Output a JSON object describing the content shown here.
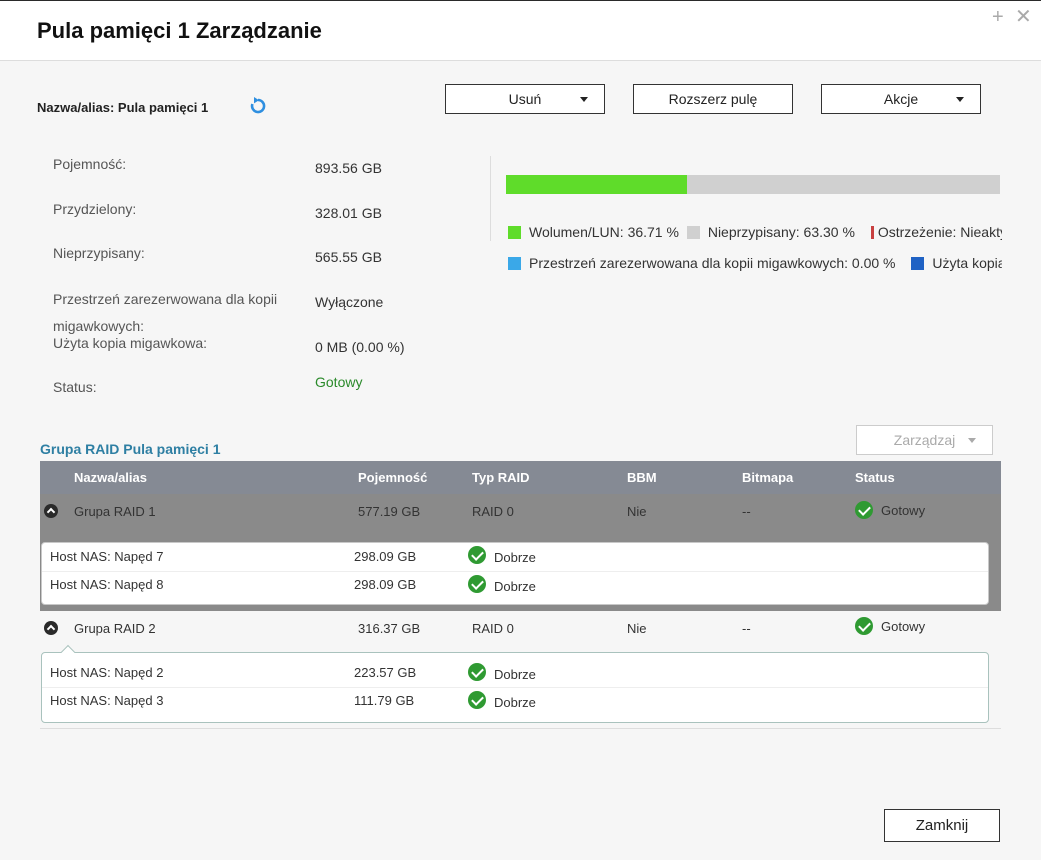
{
  "window": {
    "title": "Pula pamięci 1 Zarządzanie",
    "plus": "+",
    "close": "✕"
  },
  "header": {
    "alias_label": "Nazwa/alias: Pula pamięci 1"
  },
  "toolbar": {
    "remove": "Usuń",
    "expand": "Rozszerz pulę",
    "actions": "Akcje"
  },
  "info": {
    "capacity_label": "Pojemność:",
    "capacity_value": "893.56 GB",
    "allocated_label": "Przydzielony:",
    "allocated_value": "328.01 GB",
    "unassigned_label": "Nieprzypisany:",
    "unassigned_value": "565.55 GB",
    "snapshot_reserved_label_1": "Przestrzeń zarezerwowana dla kopii",
    "snapshot_reserved_label_2": "migawkowych:",
    "snapshot_reserved_value": "Wyłączone",
    "snapshot_used_label": "Użyta kopia migawkowa:",
    "snapshot_used_value": "0 MB (0.00 %)",
    "status_label": "Status:",
    "status_value": "Gotowy"
  },
  "usage": {
    "volume_fraction": 0.3671,
    "legend": {
      "volume_label": "Wolumen/LUN:",
      "volume_value": "36.71 %",
      "unassigned_label": "Nieprzypisany:",
      "unassigned_value": "63.30 %",
      "warning_label": "Ostrzeżenie:",
      "warning_value": "Nieaktyw",
      "snapshot_reserved_label": "Przestrzeń zarezerwowana dla kopii migawkowych:",
      "snapshot_reserved_value": "0.00 %",
      "snapshot_used_label": "Użyta kopia"
    },
    "colors": {
      "volume": "#5fdc2a",
      "unassigned": "#d0d0d0",
      "warning": "#c84040",
      "snapshot_reserved": "#3aa8e8",
      "snapshot_used": "#1f62c4"
    }
  },
  "raid": {
    "title": "Grupa RAID Pula pamięci 1",
    "manage_label": "Zarządzaj",
    "columns": {
      "name": "Nazwa/alias",
      "capacity": "Pojemność",
      "type": "Typ RAID",
      "bbm": "BBM",
      "bitmap": "Bitmapa",
      "status": "Status"
    },
    "groups": [
      {
        "name": "Grupa RAID 1",
        "capacity": "577.19 GB",
        "type": "RAID 0",
        "bbm": "Nie",
        "bitmap": "--",
        "status": "Gotowy",
        "disks": [
          {
            "name": "Host NAS: Napęd 7",
            "capacity": "298.09 GB",
            "health": "Dobrze"
          },
          {
            "name": "Host NAS: Napęd 8",
            "capacity": "298.09 GB",
            "health": "Dobrze"
          }
        ]
      },
      {
        "name": "Grupa RAID 2",
        "capacity": "316.37 GB",
        "type": "RAID 0",
        "bbm": "Nie",
        "bitmap": "--",
        "status": "Gotowy",
        "disks": [
          {
            "name": "Host NAS: Napęd 2",
            "capacity": "223.57 GB",
            "health": "Dobrze"
          },
          {
            "name": "Host NAS: Napęd 3",
            "capacity": "111.79 GB",
            "health": "Dobrze"
          }
        ]
      }
    ]
  },
  "footer": {
    "close_label": "Zamknij"
  }
}
